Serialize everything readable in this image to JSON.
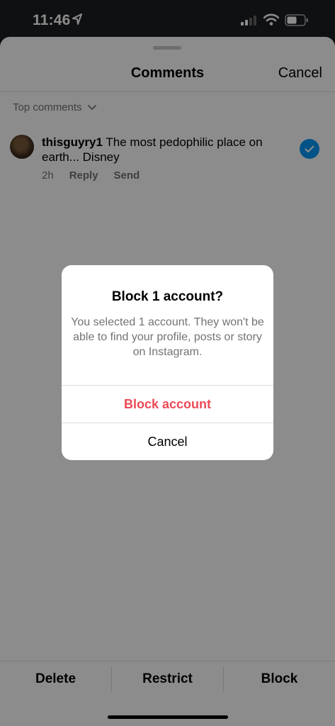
{
  "status_bar": {
    "time": "11:46",
    "icons": [
      "location-arrow-icon",
      "signal-icon",
      "wifi-icon",
      "battery-icon"
    ]
  },
  "sheet": {
    "title": "Comments",
    "cancel_label": "Cancel",
    "sort_label": "Top comments"
  },
  "comment": {
    "username": "thisguyry1",
    "text": "The most pedophilic place on earth... Disney",
    "time": "2h",
    "reply_label": "Reply",
    "send_label": "Send",
    "selected": true
  },
  "bottom_bar": {
    "delete_label": "Delete",
    "restrict_label": "Restrict",
    "block_label": "Block"
  },
  "dialog": {
    "title": "Block 1 account?",
    "message": "You selected 1 account. They won't be able to find your profile, posts or story on Instagram.",
    "confirm_label": "Block account",
    "cancel_label": "Cancel"
  },
  "colors": {
    "accent_blue": "#0095f6",
    "destructive_red": "#ed4956",
    "secondary_text": "#737373"
  }
}
